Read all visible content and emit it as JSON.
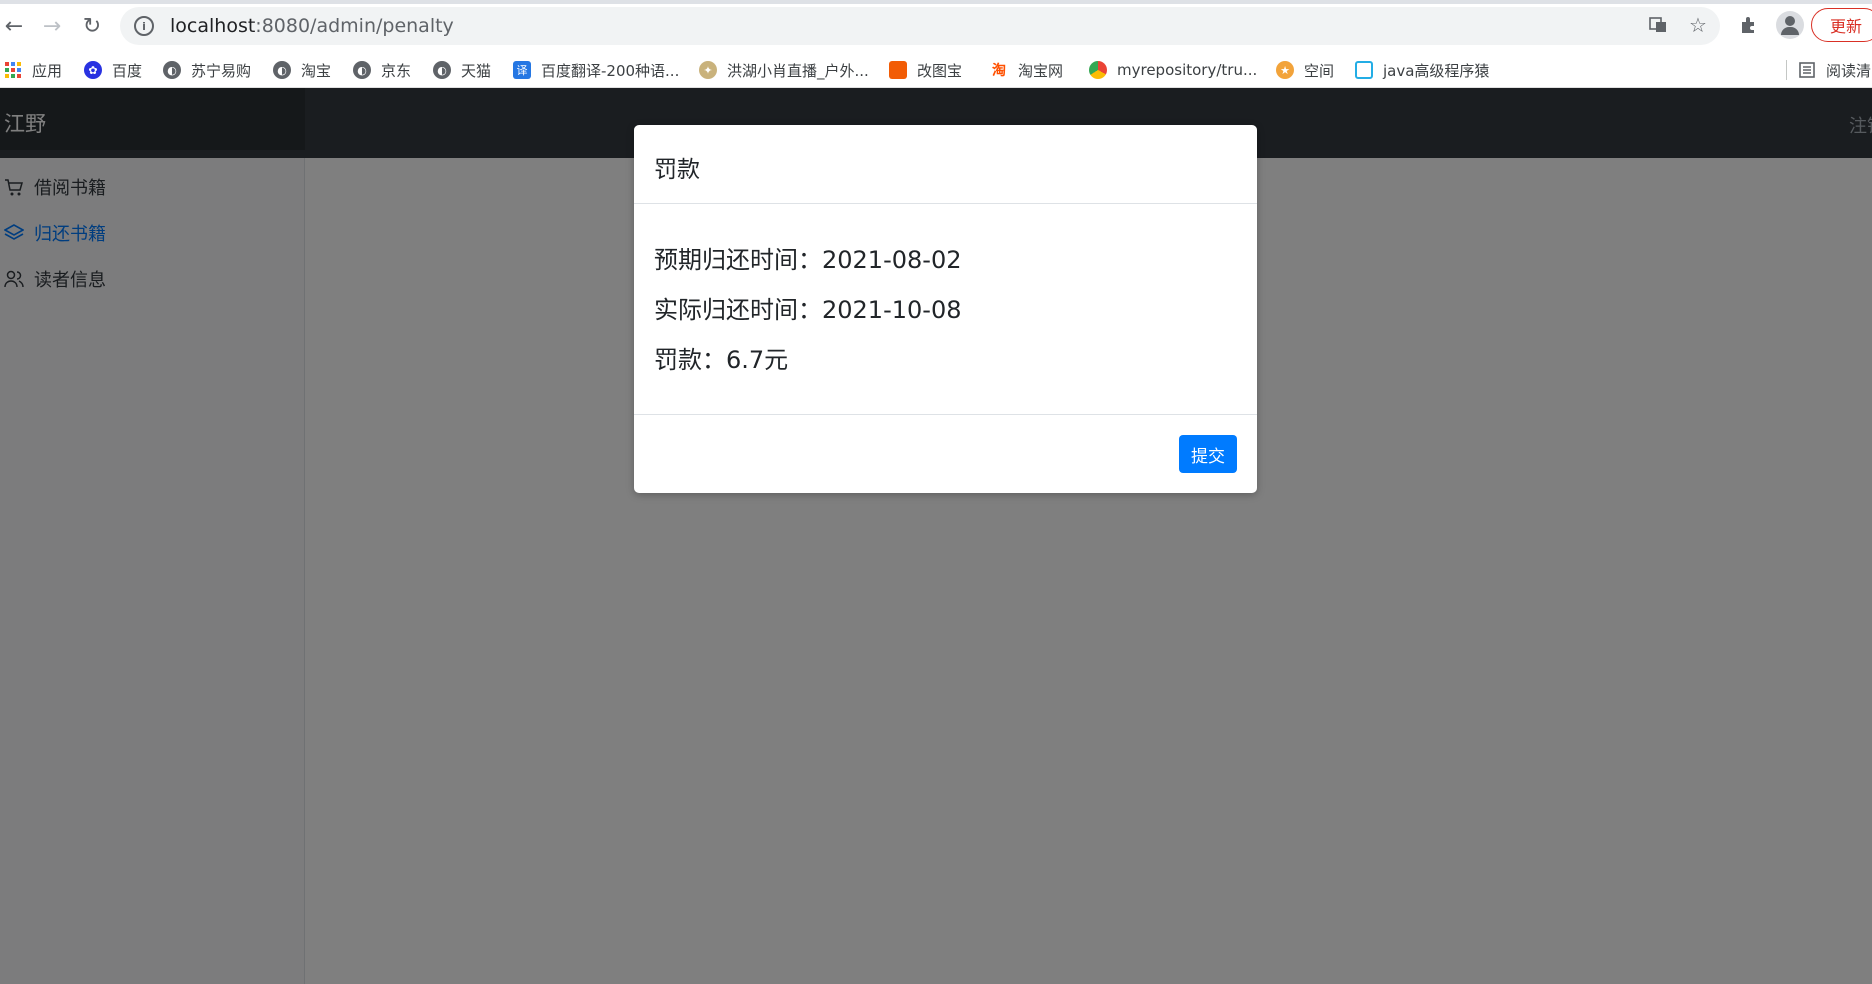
{
  "browser": {
    "url_host": "localhost",
    "url_rest": ":8080/admin/penalty",
    "update_label": "更新"
  },
  "bookmarks": [
    {
      "label": "应用",
      "icon": "apps-grid-icon"
    },
    {
      "label": "百度",
      "icon": "baidu-paw-icon"
    },
    {
      "label": "苏宁易购",
      "icon": "globe-icon"
    },
    {
      "label": "淘宝",
      "icon": "globe-icon"
    },
    {
      "label": "京东",
      "icon": "globe-icon"
    },
    {
      "label": "天猫",
      "icon": "globe-icon"
    },
    {
      "label": "百度翻译-200种语...",
      "icon": "translate-icon"
    },
    {
      "label": "洪湖小肖直播_户外...",
      "icon": "bird-icon"
    },
    {
      "label": "改图宝",
      "icon": "orange-square-icon"
    },
    {
      "label": "淘宝网",
      "icon": "taobao-icon"
    },
    {
      "label": "myrepository/tru...",
      "icon": "chrome-icon"
    },
    {
      "label": "空间",
      "icon": "qzone-icon"
    },
    {
      "label": "java高级程序猿",
      "icon": "bilibili-icon"
    }
  ],
  "reading_list_label": "阅读清",
  "colors": {
    "header_bg": "#343a40",
    "primary": "#007bff",
    "backdrop": "rgba(0,0,0,0.5)"
  },
  "app": {
    "brand": "江野",
    "header_link": "注销",
    "sidebar": [
      {
        "label": "借阅书籍",
        "icon": "cart-icon",
        "active": false
      },
      {
        "label": "归还书籍",
        "icon": "layers-icon",
        "active": true
      },
      {
        "label": "读者信息",
        "icon": "users-icon",
        "active": false
      }
    ]
  },
  "modal": {
    "title": "罚款",
    "expected_label": "预期归还时间：",
    "expected_value": "2021-08-02",
    "actual_label": "实际归还时间：",
    "actual_value": "2021-10-08",
    "fine_label": "罚款：",
    "fine_value": "6.7元",
    "submit_label": "提交"
  }
}
